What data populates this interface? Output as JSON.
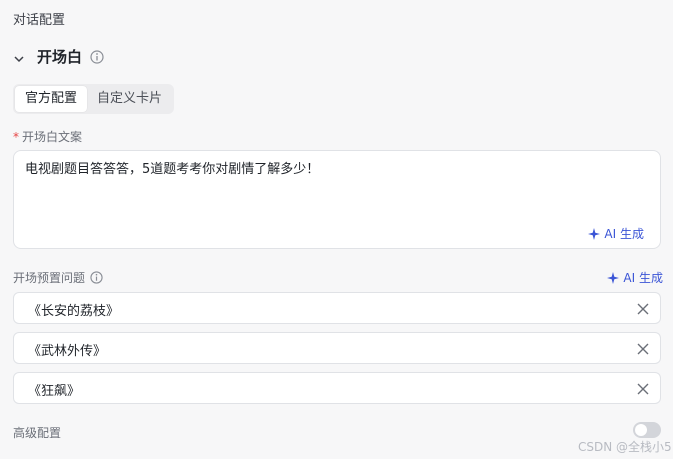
{
  "section": {
    "title": "对话配置"
  },
  "opener": {
    "title": "开场白",
    "tabs": [
      {
        "label": "官方配置",
        "active": true
      },
      {
        "label": "自定义卡片",
        "active": false
      }
    ],
    "text_label": "开场白文案",
    "required_mark": "*",
    "text_value": "电视剧题目答答答，5道题考考你对剧情了解多少！",
    "ai_generate": "AI 生成"
  },
  "preset": {
    "label": "开场预置问题",
    "ai_generate": "AI 生成",
    "questions": [
      "《长安的荔枝》",
      "《武林外传》",
      "《狂飙》"
    ]
  },
  "advanced": {
    "label": "高级配置",
    "enabled": false
  },
  "watermark": "CSDN @全栈小5",
  "icons": {
    "collapse": "chevron-down-icon",
    "info": "info-icon",
    "sparkle": "sparkle-icon",
    "close": "close-icon"
  },
  "colors": {
    "accent": "#3b55d6",
    "required": "#e54545",
    "background": "#f7f7f8"
  }
}
